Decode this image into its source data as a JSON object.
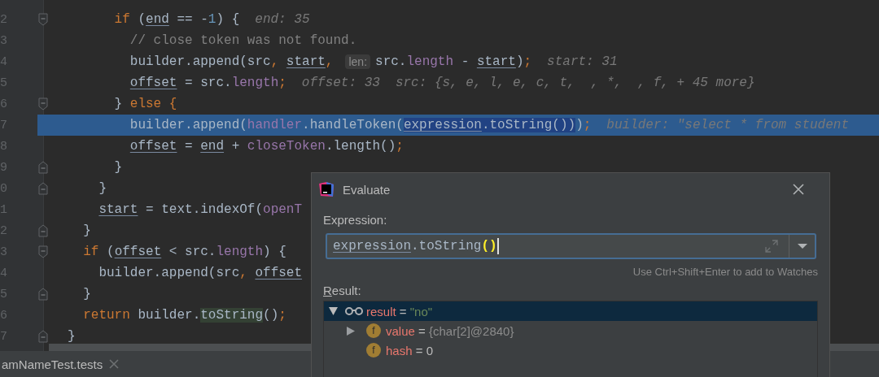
{
  "editor": {
    "lines": [
      {
        "number": "2",
        "kind": "fold_start",
        "current": false,
        "segments": [
          {
            "kind": "code",
            "tokens": [
              {
                "text": "      if",
                "kind": "keyword"
              },
              {
                "text": " (",
                "kind": "plain"
              },
              {
                "text": "end",
                "kind": "variable"
              },
              {
                "text": " == -",
                "kind": "plain"
              },
              {
                "text": "1",
                "kind": "number"
              },
              {
                "text": ") {",
                "kind": "plain"
              }
            ]
          },
          {
            "kind": "hint",
            "text": "end: 35"
          }
        ]
      },
      {
        "number": "3",
        "kind": "plain",
        "current": false,
        "segments": [
          {
            "kind": "code",
            "tokens": [
              {
                "text": "        // close token was not found.",
                "kind": "comment"
              }
            ]
          }
        ]
      },
      {
        "number": "4",
        "kind": "plain",
        "current": false,
        "segments": [
          {
            "kind": "code",
            "tokens": [
              {
                "text": "        builder.append(src",
                "kind": "plain"
              },
              {
                "text": ", ",
                "kind": "punct"
              },
              {
                "text": "start",
                "kind": "variable"
              },
              {
                "text": ",",
                "kind": "punct"
              }
            ]
          },
          {
            "kind": "param",
            "text": "len:"
          },
          {
            "kind": "code",
            "tokens": [
              {
                "text": "src.",
                "kind": "plain"
              },
              {
                "text": "length",
                "kind": "field"
              },
              {
                "text": " - ",
                "kind": "plain"
              },
              {
                "text": "start",
                "kind": "variable"
              },
              {
                "text": ")",
                "kind": "plain"
              },
              {
                "text": ";",
                "kind": "punct"
              }
            ]
          },
          {
            "kind": "hint",
            "text": "start: 31"
          }
        ]
      },
      {
        "number": "5",
        "kind": "plain",
        "current": false,
        "segments": [
          {
            "kind": "code",
            "tokens": [
              {
                "text": "        offset",
                "kind": "variable"
              },
              {
                "text": " = src.",
                "kind": "plain"
              },
              {
                "text": "length",
                "kind": "field"
              },
              {
                "text": ";",
                "kind": "punct"
              }
            ]
          },
          {
            "kind": "hint",
            "text": "offset: 33"
          },
          {
            "kind": "hint",
            "text": "src: {s, e, l, e, c, t,  , *,  , f, + 45 more}"
          }
        ]
      },
      {
        "number": "6",
        "kind": "fold_start",
        "current": false,
        "segments": [
          {
            "kind": "code",
            "tokens": [
              {
                "text": "      } ",
                "kind": "plain"
              },
              {
                "text": "else",
                "kind": "keyword"
              },
              {
                "text": " {",
                "kind": "keyword"
              }
            ]
          }
        ]
      },
      {
        "number": "7",
        "kind": "plain",
        "current": true,
        "segments": [
          {
            "kind": "code",
            "tokens": [
              {
                "text": "        builder.append(",
                "kind": "plain"
              },
              {
                "text": "handler",
                "kind": "field"
              },
              {
                "text": ".handleToken(",
                "kind": "plain"
              },
              {
                "text": "expression",
                "kind": "variable",
                "selected": true
              },
              {
                "text": ".toString())",
                "kind": "plain",
                "selected": true
              },
              {
                "text": ")",
                "kind": "plain"
              },
              {
                "text": ";",
                "kind": "punct"
              }
            ]
          },
          {
            "kind": "hint",
            "text": "builder: \"select * from student"
          }
        ]
      },
      {
        "number": "8",
        "kind": "plain",
        "current": false,
        "segments": [
          {
            "kind": "code",
            "tokens": [
              {
                "text": "        offset",
                "kind": "variable"
              },
              {
                "text": " = ",
                "kind": "plain"
              },
              {
                "text": "end",
                "kind": "variable"
              },
              {
                "text": " + ",
                "kind": "plain"
              },
              {
                "text": "closeToken",
                "kind": "field"
              },
              {
                "text": ".length()",
                "kind": "plain"
              },
              {
                "text": ";",
                "kind": "punct"
              }
            ]
          }
        ]
      },
      {
        "number": "9",
        "kind": "fold_end",
        "current": false,
        "segments": [
          {
            "kind": "code",
            "tokens": [
              {
                "text": "      }",
                "kind": "plain"
              }
            ]
          }
        ]
      },
      {
        "number": "0",
        "kind": "fold_end",
        "current": false,
        "segments": [
          {
            "kind": "code",
            "tokens": [
              {
                "text": "    }",
                "kind": "plain"
              }
            ]
          }
        ]
      },
      {
        "number": "1",
        "kind": "plain",
        "current": false,
        "segments": [
          {
            "kind": "code",
            "tokens": [
              {
                "text": "    start",
                "kind": "variable"
              },
              {
                "text": " = text.indexOf(",
                "kind": "plain"
              },
              {
                "text": "openT",
                "kind": "field"
              }
            ]
          }
        ]
      },
      {
        "number": "2",
        "kind": "fold_end",
        "current": false,
        "segments": [
          {
            "kind": "code",
            "tokens": [
              {
                "text": "  }",
                "kind": "plain"
              }
            ]
          }
        ]
      },
      {
        "number": "3",
        "kind": "fold_start",
        "current": false,
        "segments": [
          {
            "kind": "code",
            "tokens": [
              {
                "text": "  if",
                "kind": "keyword"
              },
              {
                "text": " (",
                "kind": "plain"
              },
              {
                "text": "offset",
                "kind": "variable"
              },
              {
                "text": " < src.",
                "kind": "plain"
              },
              {
                "text": "length",
                "kind": "field"
              },
              {
                "text": ") {",
                "kind": "plain"
              }
            ]
          }
        ]
      },
      {
        "number": "4",
        "kind": "plain",
        "current": false,
        "segments": [
          {
            "kind": "code",
            "tokens": [
              {
                "text": "    builder.append(src",
                "kind": "plain"
              },
              {
                "text": ", ",
                "kind": "punct"
              },
              {
                "text": "offset",
                "kind": "variable"
              }
            ]
          }
        ]
      },
      {
        "number": "5",
        "kind": "fold_end",
        "current": false,
        "segments": [
          {
            "kind": "code",
            "tokens": [
              {
                "text": "  }",
                "kind": "plain"
              }
            ]
          }
        ]
      },
      {
        "number": "6",
        "kind": "plain",
        "current": false,
        "segments": [
          {
            "kind": "code",
            "tokens": [
              {
                "text": "  return",
                "kind": "keyword"
              },
              {
                "text": " builder.",
                "kind": "plain"
              },
              {
                "text": "toString",
                "kind": "plain",
                "highlighted": true
              },
              {
                "text": "()",
                "kind": "plain"
              },
              {
                "text": ";",
                "kind": "punct"
              }
            ]
          }
        ]
      },
      {
        "number": "7",
        "kind": "fold_end",
        "current": false,
        "segments": [
          {
            "kind": "code",
            "tokens": [
              {
                "text": "}",
                "kind": "plain"
              }
            ]
          }
        ]
      }
    ]
  },
  "editor_tabs": [
    {
      "label": "amNameTest.tests"
    }
  ],
  "dialog": {
    "title": "Evaluate",
    "expression_label": "Expression:",
    "expression": {
      "tokens": [
        {
          "text": "expression",
          "kind": "variable"
        },
        {
          "text": ".toString",
          "kind": "plain"
        },
        {
          "text": "()",
          "kind": "brace"
        }
      ]
    },
    "hint": "Use Ctrl+Shift+Enter to add to Watches",
    "result_label": "Result:",
    "result": [
      {
        "kind": "watch",
        "name": "result",
        "operator": "=",
        "value": {
          "kind": "string",
          "text": "\"no\""
        },
        "expanded": true,
        "selected": true,
        "children": [
          {
            "kind": "field",
            "badge": "f",
            "name": "value",
            "operator": "=",
            "value": {
              "kind": "object",
              "text": "{char[2]@2840}"
            },
            "expanded": false,
            "selected": false
          },
          {
            "kind": "field",
            "badge": "f",
            "name": "hash",
            "operator": "=",
            "value": {
              "kind": "number",
              "text": "0"
            },
            "selected": false
          }
        ]
      }
    ]
  }
}
